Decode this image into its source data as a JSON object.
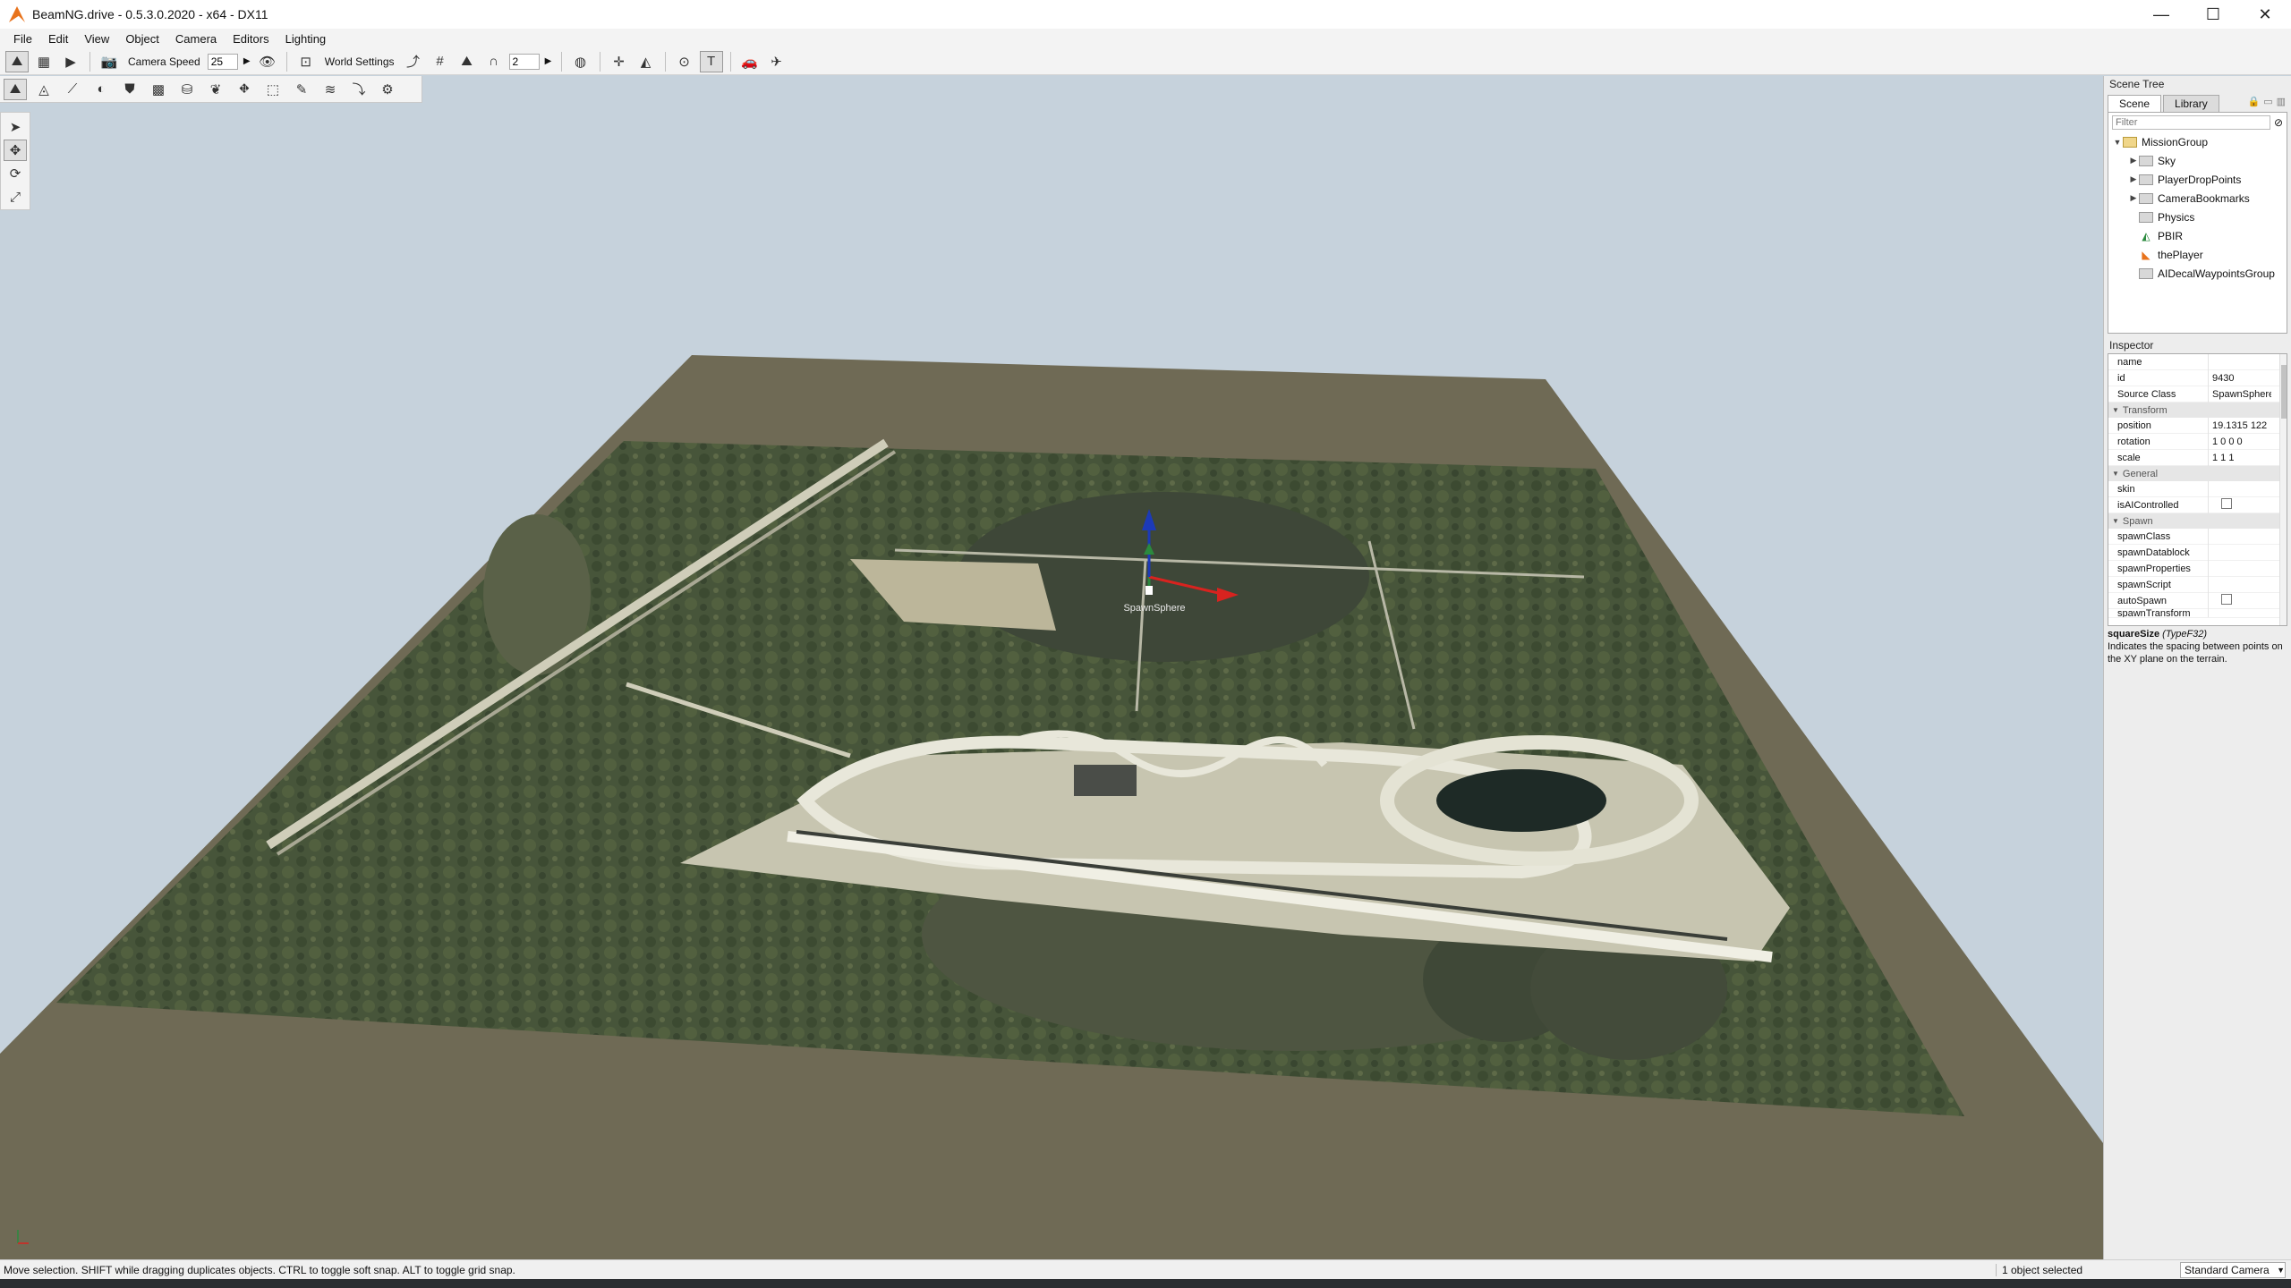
{
  "window": {
    "title": "BeamNG.drive - 0.5.3.0.2020 - x64 - DX11",
    "minimize": "—",
    "maximize": "☐",
    "close": "✕"
  },
  "menu": [
    "File",
    "Edit",
    "View",
    "Object",
    "Camera",
    "Editors",
    "Lighting"
  ],
  "toolbar": {
    "camera_speed_label": "Camera Speed",
    "camera_speed_value": "25",
    "world_settings_label": "World Settings",
    "grid_value": "2"
  },
  "viewport": {
    "spawn_label": "SpawnSphere",
    "colors": {
      "sky": "#c6d2dc",
      "ground": "#6f6a55",
      "terrain_base": "#47553a",
      "track": "#d3d2c4"
    }
  },
  "scene_tree": {
    "title": "Scene Tree",
    "tabs": [
      "Scene",
      "Library"
    ],
    "filter_placeholder": "Filter",
    "items": [
      {
        "label": "MissionGroup",
        "icon": "folder-open-icon",
        "expander": "▼"
      },
      {
        "label": "Sky",
        "icon": "folder-icon",
        "expander": "▶"
      },
      {
        "label": "PlayerDropPoints",
        "icon": "folder-icon",
        "expander": "▶"
      },
      {
        "label": "CameraBookmarks",
        "icon": "folder-icon",
        "expander": "▶"
      },
      {
        "label": "Physics",
        "icon": "folder-icon",
        "expander": ""
      },
      {
        "label": "PBIR",
        "icon": "terrain-icon",
        "expander": ""
      },
      {
        "label": "thePlayer",
        "icon": "player-icon",
        "expander": ""
      },
      {
        "label": "AIDecalWaypointsGroup",
        "icon": "folder-icon",
        "expander": ""
      }
    ]
  },
  "inspector": {
    "title": "Inspector",
    "top_rows": [
      {
        "name": "name",
        "value": ""
      },
      {
        "name": "id",
        "value": "9430"
      },
      {
        "name": "Source Class",
        "value": "SpawnSphere"
      }
    ],
    "sections": {
      "transform": "Transform",
      "general": "General",
      "spawn": "Spawn"
    },
    "transform_rows": [
      {
        "name": "position",
        "value": "19.1315 122"
      },
      {
        "name": "rotation",
        "value": "1 0 0 0"
      },
      {
        "name": "scale",
        "value": "1 1 1"
      }
    ],
    "general_rows": {
      "skin": "skin",
      "is_ai_controlled": "isAIControlled"
    },
    "spawn_rows": [
      "spawnClass",
      "spawnDatablock",
      "spawnProperties",
      "spawnScript"
    ],
    "auto_spawn": "autoSpawn",
    "spawn_transform": "spawnTransform",
    "doc_name": "squareSize",
    "doc_type": "(TypeF32)",
    "doc_text": "Indicates the spacing between points on the XY plane on the terrain."
  },
  "status": {
    "message": "Move selection.  SHIFT while dragging duplicates objects.  CTRL to toggle soft snap.  ALT to toggle grid snap.",
    "selection": "1 object selected",
    "camera_mode": "Standard Camera"
  }
}
